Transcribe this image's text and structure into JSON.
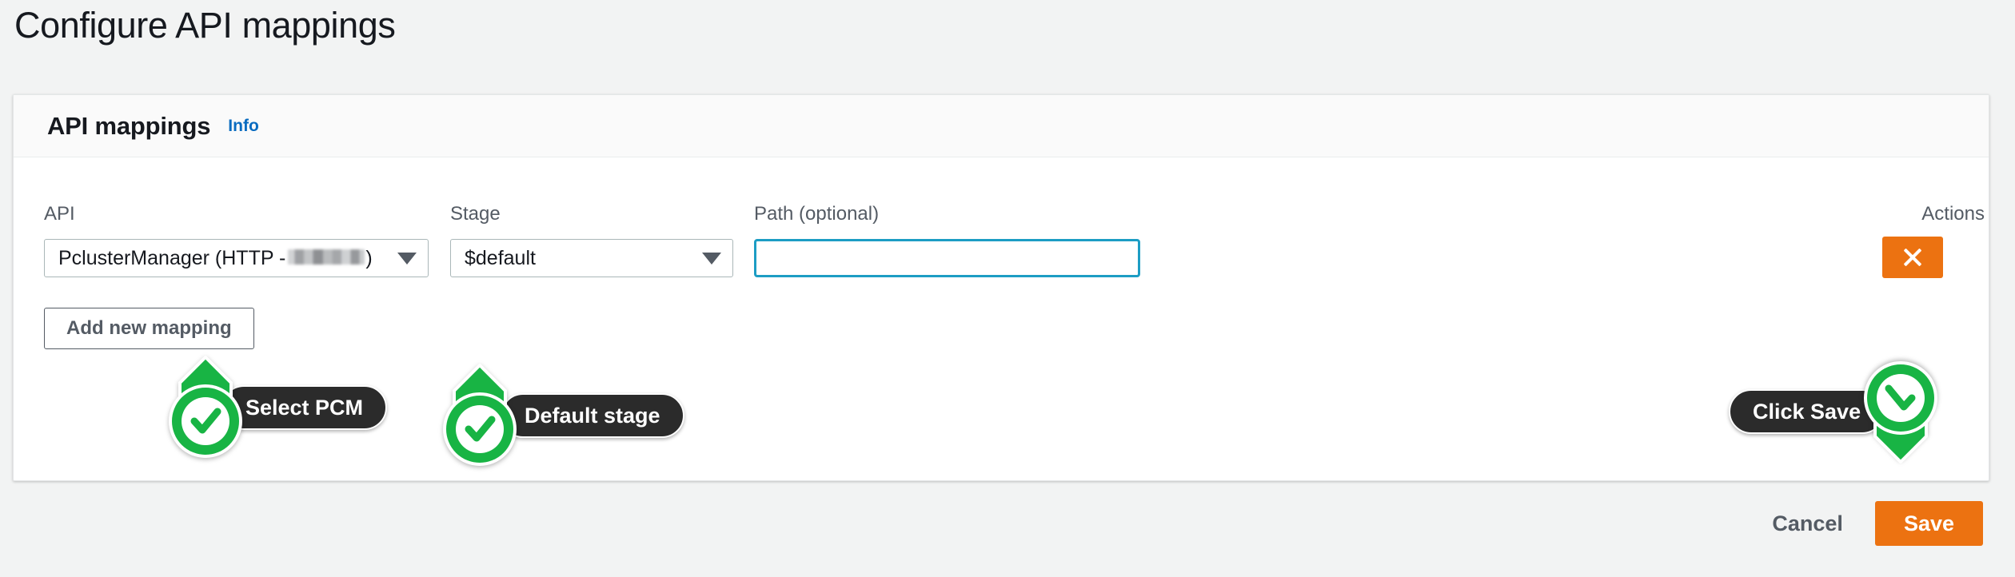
{
  "page": {
    "title": "Configure API mappings",
    "background_color": "#f2f3f3"
  },
  "card": {
    "header": {
      "title": "API mappings",
      "info_link": "Info"
    },
    "columns": {
      "api": "API",
      "stage": "Stage",
      "path": "Path (optional)",
      "actions": "Actions"
    },
    "row": {
      "api_select_value": "PclusterManager (HTTP - ",
      "api_select_value_suffix": ")",
      "api_select_redacted": true,
      "stage_select_value": "$default",
      "path_value": "",
      "path_placeholder": "",
      "delete_icon": "close-x-icon"
    },
    "add_mapping_label": "Add new mapping"
  },
  "footer": {
    "cancel_label": "Cancel",
    "save_label": "Save"
  },
  "annotations": [
    {
      "id": "select-pcm",
      "label": "Select PCM",
      "marker": "check-circle-icon",
      "direction": "up"
    },
    {
      "id": "default-stage",
      "label": "Default stage",
      "marker": "check-circle-icon",
      "direction": "up"
    },
    {
      "id": "click-save",
      "label": "Click Save",
      "marker": "check-circle-icon",
      "direction": "down"
    }
  ],
  "colors": {
    "accent_orange": "#ec7211",
    "link_blue": "#0a6cc0",
    "focus_teal": "#1d9dc4",
    "annotation_green": "#18b444",
    "annotation_pill": "#2b2b2b",
    "text_dark": "#16191f",
    "text_muted": "#545b64"
  }
}
